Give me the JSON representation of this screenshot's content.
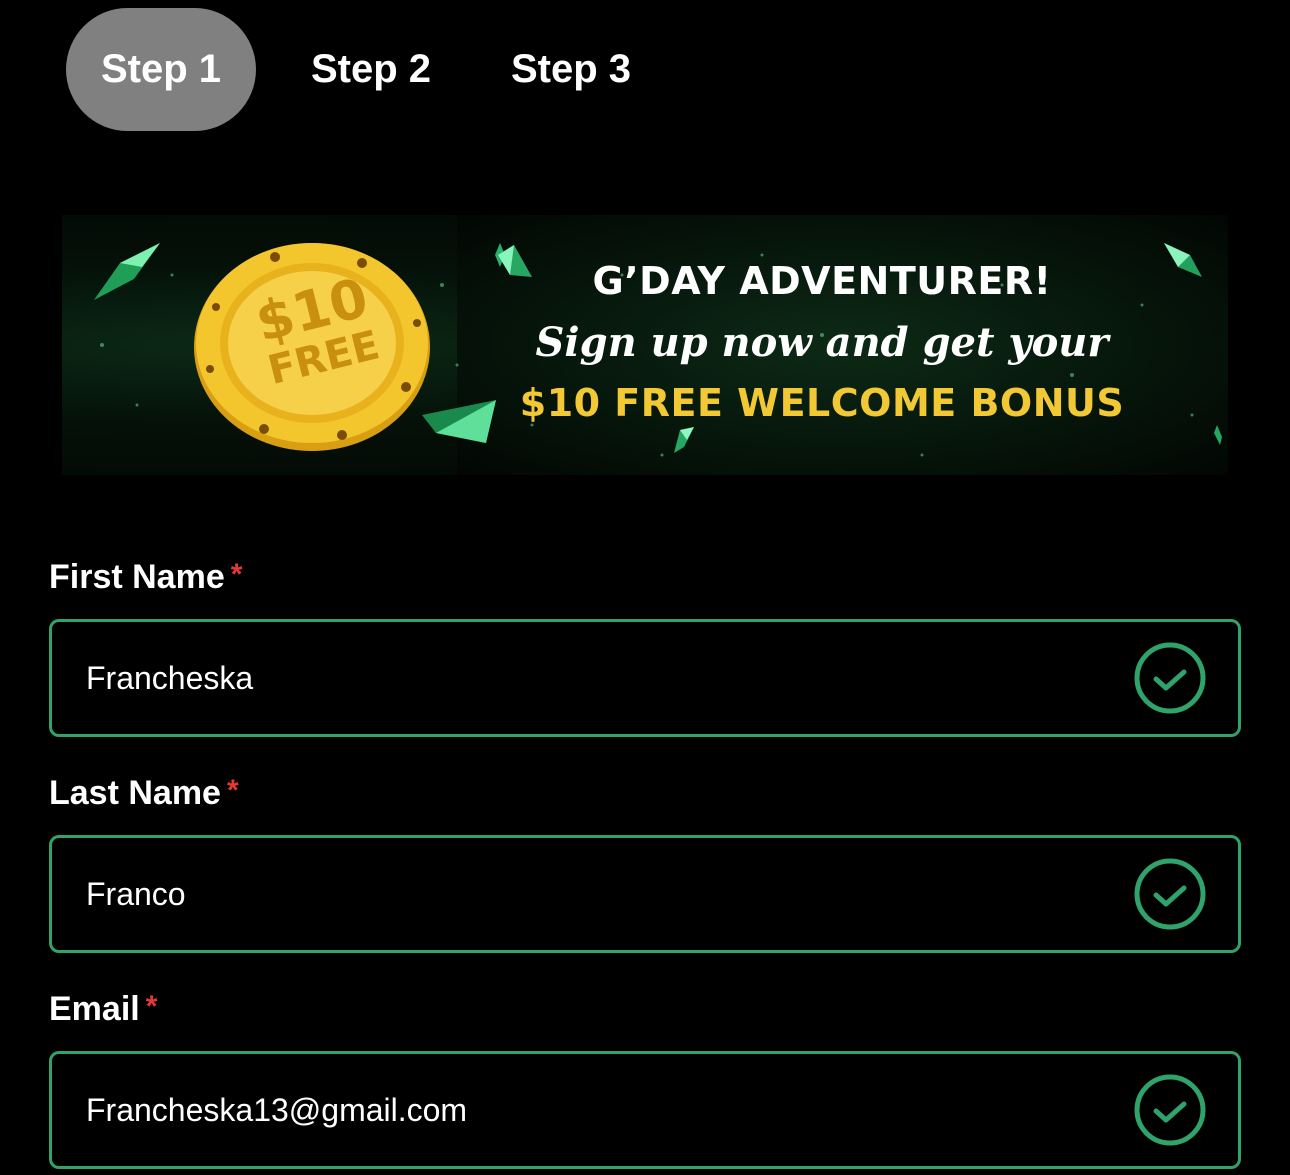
{
  "steps": [
    {
      "label": "Step 1",
      "active": true
    },
    {
      "label": "Step 2",
      "active": false
    },
    {
      "label": "Step 3",
      "active": false
    }
  ],
  "banner": {
    "chip_amount": "$10",
    "chip_free": "FREE",
    "title": "G’DAY ADVENTURER!",
    "script_line": "Sign up now and get your",
    "bonus_line": "$10 FREE WELCOME BONUS"
  },
  "form": {
    "first_name": {
      "label": "First Name",
      "required_mark": "*",
      "value": "Francheska",
      "valid": true
    },
    "last_name": {
      "label": "Last Name",
      "required_mark": "*",
      "value": "Franco",
      "valid": true
    },
    "email": {
      "label": "Email",
      "required_mark": "*",
      "value": "Francheska13@gmail.com",
      "valid": true
    }
  },
  "colors": {
    "background": "#000000",
    "active_step": "#808080",
    "field_border": "#2fa36a",
    "check": "#2fa36a",
    "required": "#e53935",
    "bonus_text": "#f2c935"
  },
  "icons": {
    "field_valid": "check-circle-icon",
    "banner_gems": "emerald-gem-icon",
    "banner_chip": "gold-casino-chip"
  }
}
